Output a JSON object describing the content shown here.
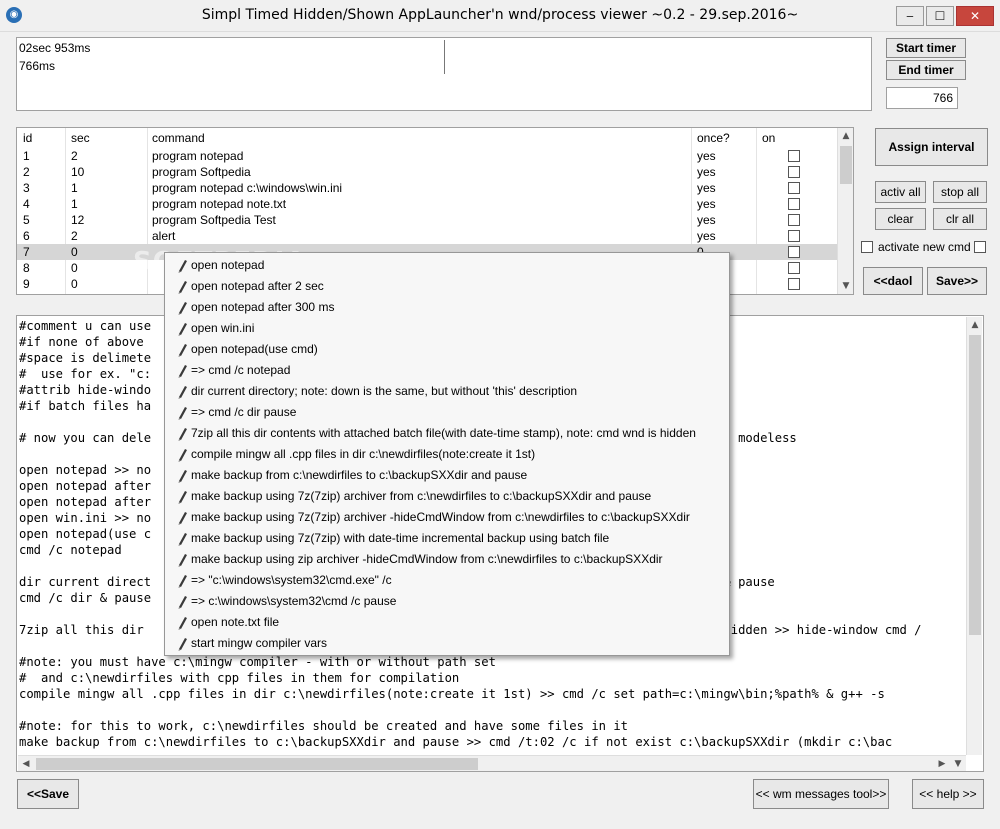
{
  "window": {
    "title": "Simpl Timed Hidden/Shown AppLauncher'n wnd/process viewer ~0.2 - 29.sep.2016~",
    "minimize_glyph": "‒",
    "maximize_glyph": "☐",
    "close_glyph": "✕"
  },
  "timer": {
    "lines": [
      "02sec 953ms",
      "766ms"
    ],
    "start_label": "Start timer",
    "end_label": "End timer",
    "interval_value": "766"
  },
  "table": {
    "columns": [
      "id",
      "sec",
      "command",
      "once?",
      "on"
    ],
    "rows": [
      {
        "id": "1",
        "sec": "2",
        "command": "program notepad",
        "once": "yes"
      },
      {
        "id": "2",
        "sec": "10",
        "command": "program Softpedia",
        "once": "yes"
      },
      {
        "id": "3",
        "sec": "1",
        "command": "program notepad c:\\windows\\win.ini",
        "once": "yes"
      },
      {
        "id": "4",
        "sec": "1",
        "command": "program notepad note.txt",
        "once": "yes"
      },
      {
        "id": "5",
        "sec": "12",
        "command": "program Softpedia Test",
        "once": "yes"
      },
      {
        "id": "6",
        "sec": "2",
        "command": "alert",
        "once": "yes"
      },
      {
        "id": "7",
        "sec": "0",
        "command": "",
        "once": "0"
      },
      {
        "id": "8",
        "sec": "0",
        "command": "",
        "once": "0"
      },
      {
        "id": "9",
        "sec": "0",
        "command": "",
        "once": "0"
      }
    ]
  },
  "side": {
    "assign_label": "Assign interval",
    "activ_all_label": "activ all",
    "stop_all_label": "stop all",
    "clear_label": "clear",
    "clr_all_label": "clr all",
    "activate_new_label": "activate new cmd",
    "load_label": "<<daol",
    "save_label": "Save>>"
  },
  "editor_lines": [
    "#comment u can use",
    "#if none of above",
    "#space is delimete",
    "#  use for ex. \"c:",
    "#attrib hide-windo",
    "#if batch files ha",
    "",
    "# now you can dele                                                                           it's modeless",
    "",
    "open notepad >> no",
    "open notepad after",
    "open notepad after",
    "open win.ini >> no",
    "open notepad(use c",
    "cmd /c notepad",
    "",
    "dir current direct                                                                           ir & pause",
    "cmd /c dir & pause",
    "",
    "7zip all this dir                                                                            is hidden >> hide-window cmd /",
    "",
    "#note: you must have c:\\mingw compiler - with or without path set",
    "#  and c:\\newdirfiles with cpp files in them for compilation",
    "compile mingw all .cpp files in dir c:\\newdirfiles(note:create it 1st) >> cmd /c set path=c:\\mingw\\bin;%path% & g++ -s",
    "",
    "#note: for this to work, c:\\newdirfiles should be created and have some files in it",
    "make backup from c:\\newdirfiles to c:\\backupSXXdir and pause >> cmd /t:02 /c if not exist c:\\backupSXXdir (mkdir c:\\bac"
  ],
  "popup_items": [
    "open notepad",
    "open notepad after 2 sec",
    "open notepad after 300 ms",
    "open win.ini",
    "open notepad(use cmd)",
    "=> cmd /c notepad",
    "dir current directory; note: down is the same, but without 'this' description",
    "=> cmd /c dir  pause",
    "7zip all this dir contents with attached batch file(with date-time stamp), note: cmd wnd is hidden",
    "compile mingw all .cpp files in dir c:\\newdirfiles(note:create it 1st)",
    "make backup from c:\\newdirfiles to c:\\backupSXXdir and pause",
    "make backup using 7z(7zip) archiver from c:\\newdirfiles to c:\\backupSXXdir and pause",
    "make backup using 7z(7zip) archiver -hideCmdWindow from c:\\newdirfiles to c:\\backupSXXdir",
    "make backup using 7z(7zip) with date-time incremental backup using batch file",
    "make backup using zip archiver -hideCmdWindow from c:\\newdirfiles to c:\\backupSXXdir",
    "=> \"c:\\windows\\system32\\cmd.exe\" /c",
    "=> c:\\windows\\system32\\cmd /c pause",
    "open note.txt file",
    "start mingw compiler vars"
  ],
  "bottom": {
    "save_label": "<<Save",
    "wm_tool_label": "<< wm messages tool>>",
    "help_label": "<< help >>"
  },
  "watermark": "SOFTPEDIA",
  "colors": {
    "window_bg": "#f0f0f0",
    "selected_row": "#d6d6d6",
    "close_button": "#c7463d",
    "app_icon": "#2a6fb5"
  }
}
